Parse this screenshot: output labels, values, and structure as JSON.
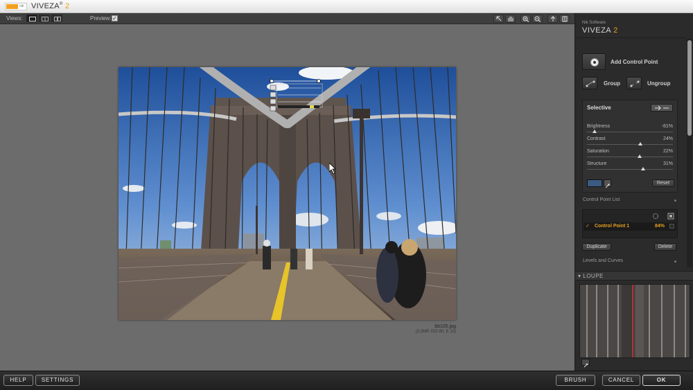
{
  "app": {
    "title_main": "VIVEZA",
    "title_version": "2",
    "title_sup": "®",
    "logo_text": "nik"
  },
  "toolbar": {
    "views_label": "Views:",
    "preview_label": "Preview:",
    "preview_checked": "✓"
  },
  "photo": {
    "filename": "bb105.jpg",
    "meta": "(3.3MP, ISO 80, E 10)"
  },
  "panel": {
    "brand_small": "Nik Software",
    "brand_main": "VIVEZA",
    "brand_version": "2",
    "add_control_point": "Add Control Point",
    "group": "Group",
    "ungroup": "Ungroup",
    "selective": {
      "title": "Selective",
      "sliders": [
        {
          "name": "Brightness",
          "value": "-81%",
          "pos": 0.09
        },
        {
          "name": "Contrast",
          "value": "24%",
          "pos": 0.62
        },
        {
          "name": "Saturation",
          "value": "22%",
          "pos": 0.61
        },
        {
          "name": "Structure",
          "value": "31%",
          "pos": 0.65
        }
      ],
      "reset": "Reset"
    },
    "control_point_list": {
      "header": "Control Point List",
      "check": "✓",
      "item_name": "Control Point 1",
      "item_value": "84%",
      "duplicate": "Duplicate",
      "delete": "Delete"
    },
    "levels_and_curves": "Levels and Curves",
    "loupe": "LOUPE",
    "loupe_arrow": "▾"
  },
  "bottom": {
    "help": "HELP",
    "settings": "SETTINGS",
    "brush": "BRUSH",
    "cancel": "CANCEL",
    "ok": "OK"
  },
  "colors": {
    "accent": "#e8a020",
    "panel_bg": "#2b2b2b",
    "canvas_bg": "#6c6c6c"
  }
}
